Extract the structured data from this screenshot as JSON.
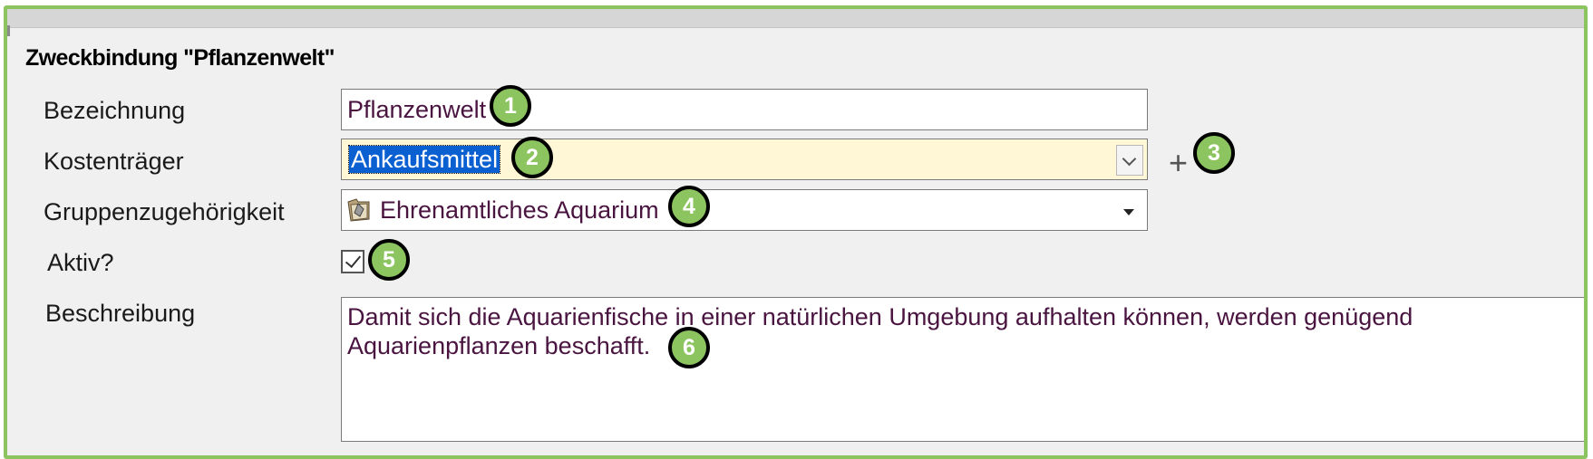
{
  "form": {
    "title": "Zweckbindung \"Pflanzenwelt\""
  },
  "fields": {
    "bezeichnung": {
      "label": "Bezeichnung",
      "value": "Pflanzenwelt"
    },
    "kostentraeger": {
      "label": "Kostenträger",
      "value": "Ankaufsmittel",
      "add_label": "+"
    },
    "gruppe": {
      "label": "Gruppenzugehörigkeit",
      "value": "Ehrenamtliches Aquarium",
      "icon": "group-folder-icon"
    },
    "aktiv": {
      "label": "Aktiv?",
      "checked": true
    },
    "beschreibung": {
      "label": "Beschreibung",
      "value": "Damit sich die Aquarienfische in einer natürlichen Umgebung aufhalten können, werden genügend Aquarienpflanzen beschafft."
    }
  },
  "annotations": [
    "1",
    "2",
    "3",
    "4",
    "5",
    "6"
  ],
  "colors": {
    "accent": "#8cc560",
    "selection": "#0a5fd1",
    "input_highlight": "#fff7d6",
    "value_text": "#4a1440"
  }
}
